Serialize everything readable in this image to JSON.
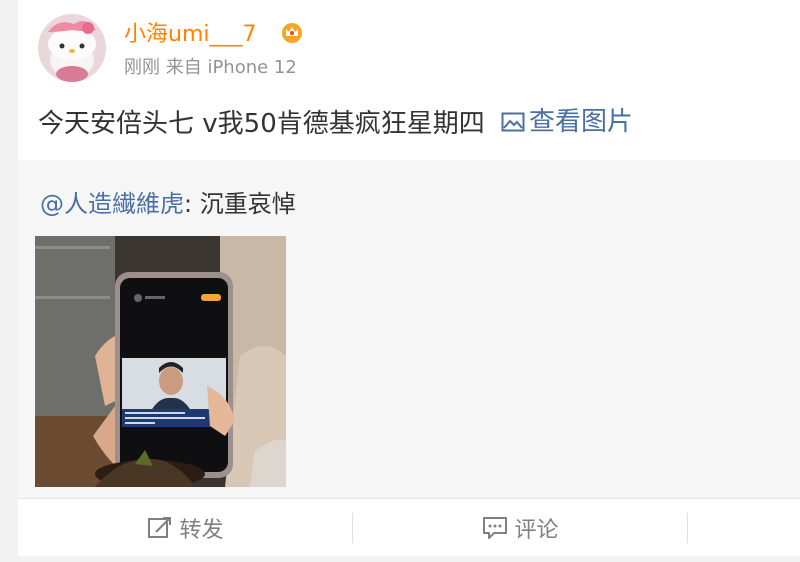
{
  "author": {
    "username": "小海umi___7",
    "meta": "刚刚 来自 iPhone 12"
  },
  "post": {
    "text": "今天安倍头七 v我50肯德基疯狂星期四",
    "view_pic_label": "查看图片"
  },
  "retweet": {
    "author": "@人造繊維虎",
    "separator": ": ",
    "text": "沉重哀悼"
  },
  "actions": {
    "repost_label": "转发",
    "comment_label": "评论"
  },
  "colors": {
    "username": "#ff8200",
    "link": "#4a6fa5",
    "meta": "#939393"
  }
}
